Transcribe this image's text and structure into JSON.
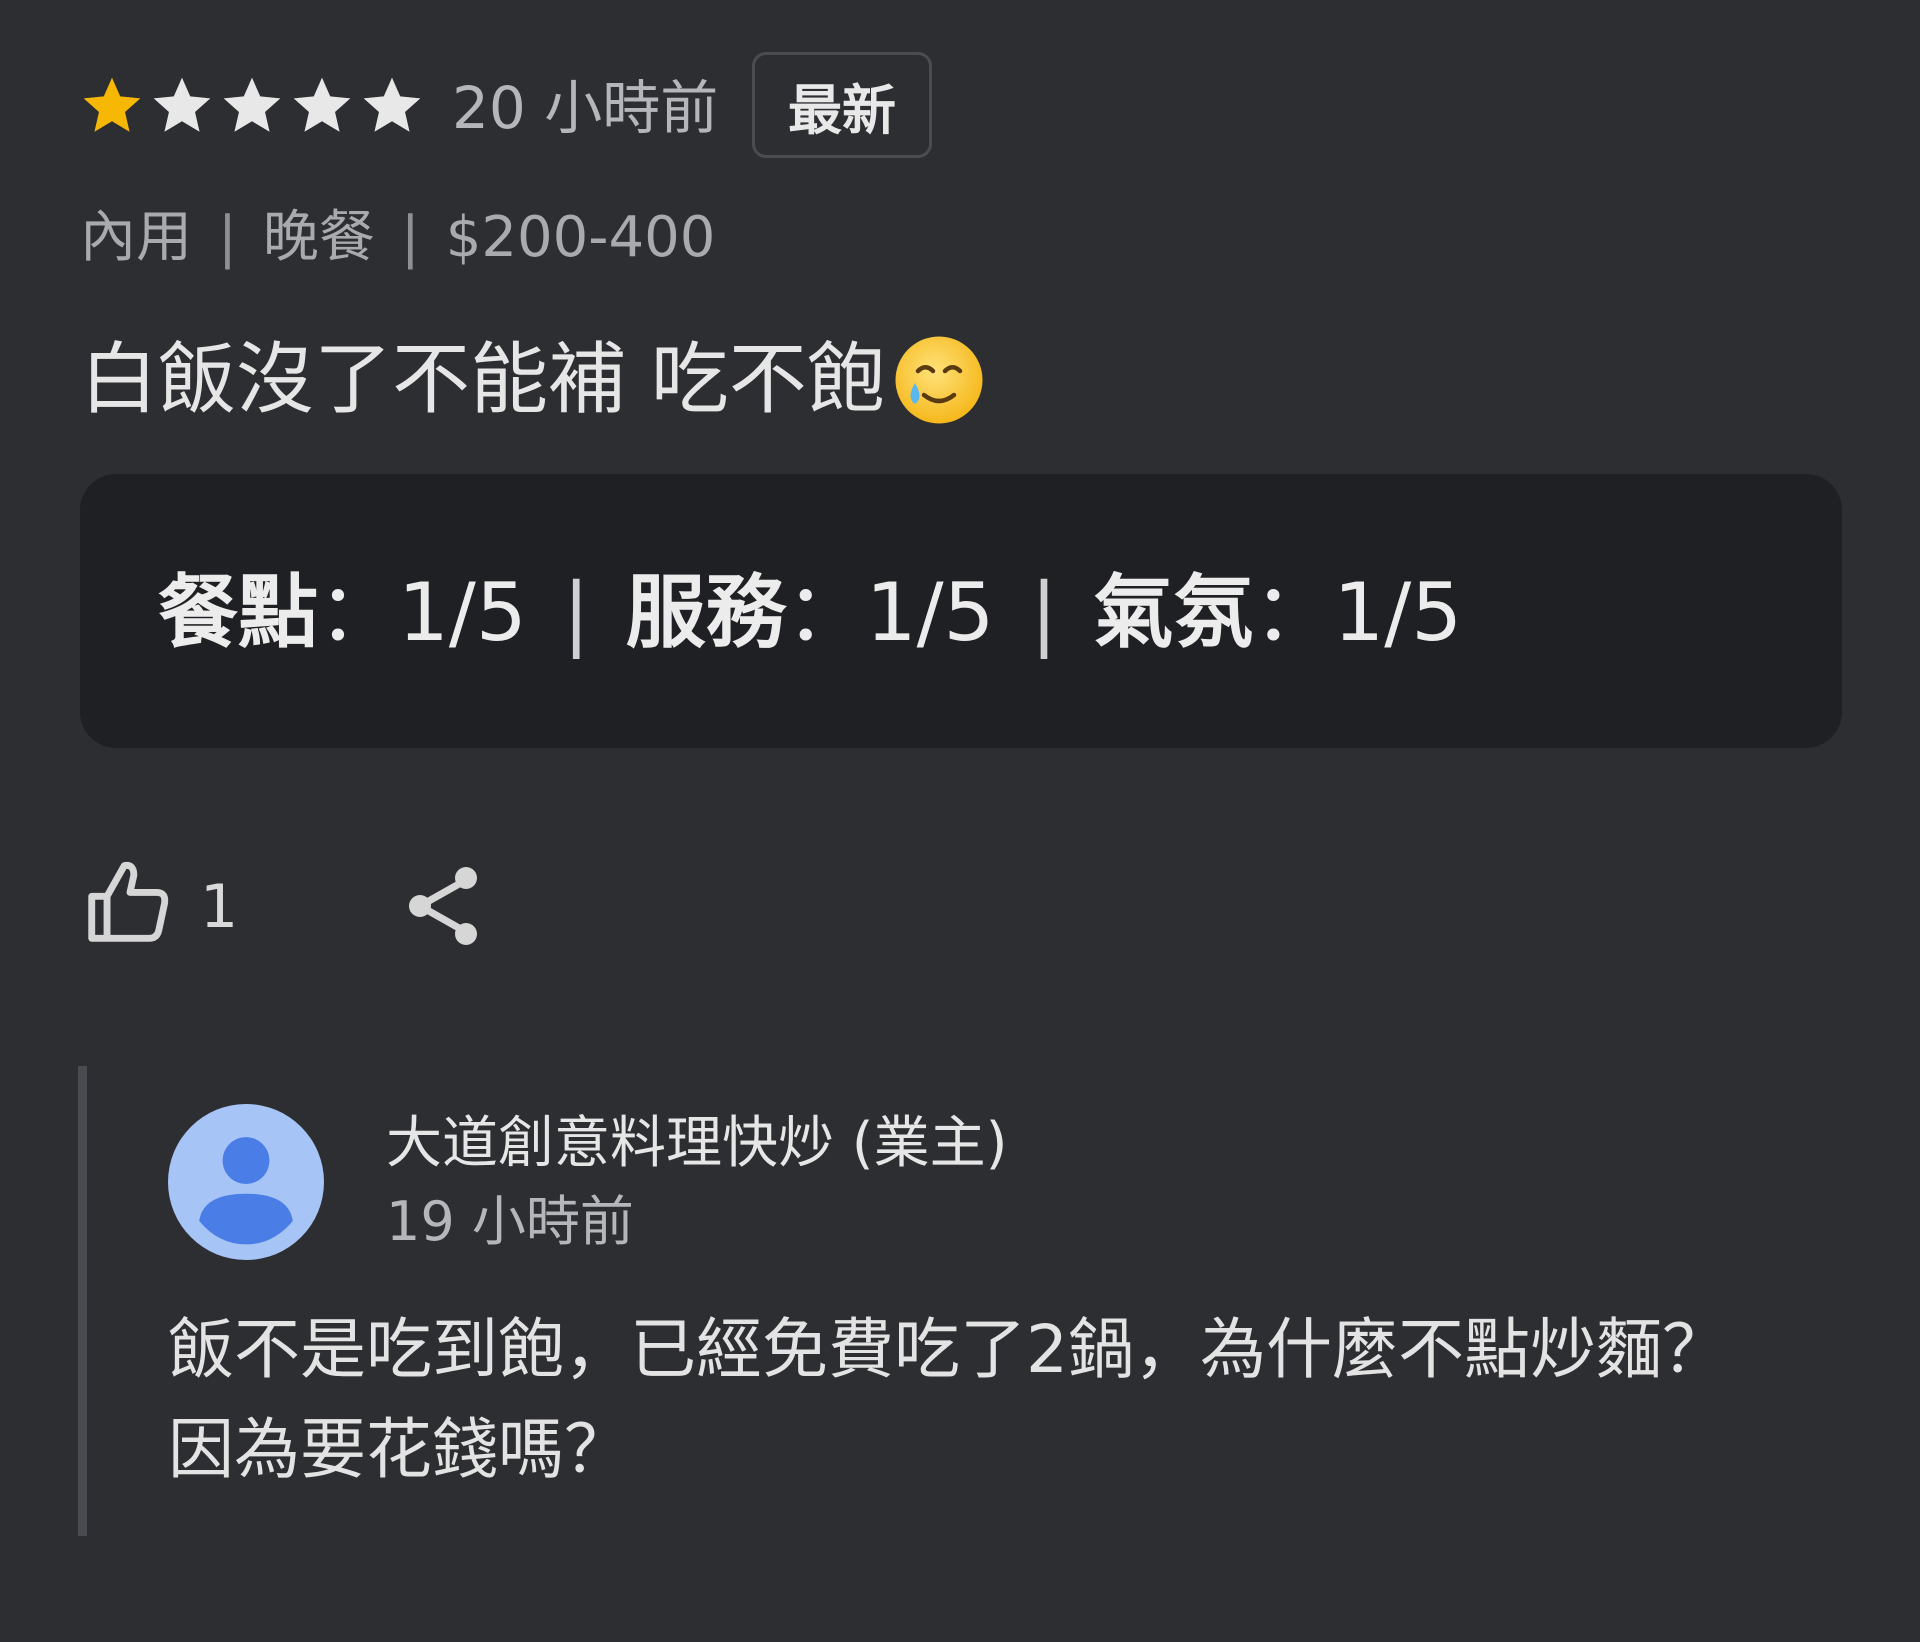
{
  "review": {
    "rating": 1,
    "max_rating": 5,
    "star_color_filled": "#f6b705",
    "star_color_empty": "#e8e8e8",
    "time": "20 小時前",
    "badge": "最新",
    "meta": {
      "service": "內用",
      "meal": "晚餐",
      "price": "$200-400"
    },
    "text": "白飯沒了不能補 吃不飽",
    "emoji": "smiling-face-with-tear",
    "sub_ratings": {
      "food_label": "餐點",
      "food_value": "1/5",
      "service_label": "服務",
      "service_value": "1/5",
      "atmosphere_label": "氣氛",
      "atmosphere_value": "1/5",
      "colon": "：",
      "separator": "|"
    },
    "actions": {
      "like_count": "1",
      "like_icon": "thumbs-up-icon",
      "share_icon": "share-icon"
    }
  },
  "owner_reply": {
    "name": "大道創意料理快炒 (業主)",
    "time": "19 小時前",
    "avatar_color": "#a6c4f6",
    "avatar_fg": "#4a7ee6",
    "text_line1": "飯不是吃到飽，已經免費吃了2鍋，為什麼不點炒麵？",
    "text_line2": "因為要花錢嗎？"
  }
}
